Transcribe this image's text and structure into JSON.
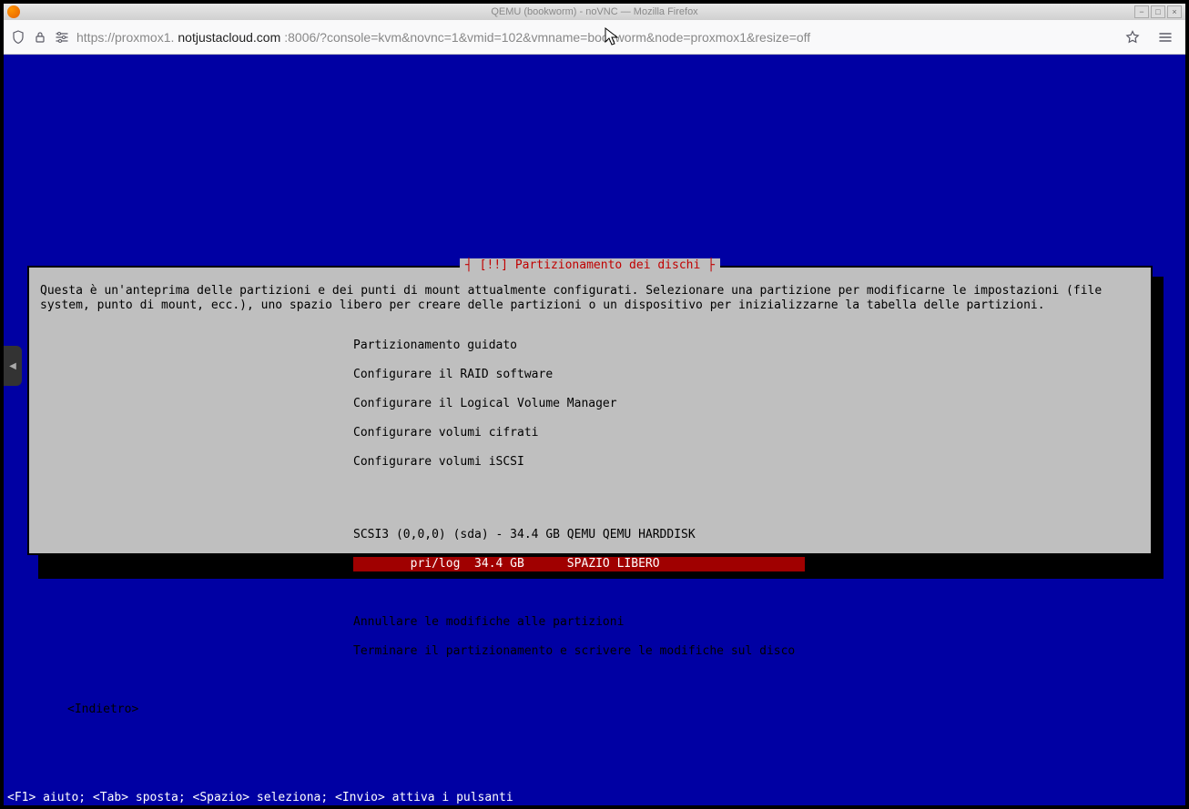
{
  "window": {
    "title": "QEMU (bookworm) - noVNC — Mozilla Firefox"
  },
  "browser": {
    "url_prefix": "https://proxmox1.",
    "url_domain": "notjustacloud.com",
    "url_suffix": ":8006/?console=kvm&novnc=1&vmid=102&vmname=bookworm&node=proxmox1&resize=off"
  },
  "novnc": {
    "tab_glyph": "◀"
  },
  "installer": {
    "title": "┤ [!!] Partizionamento dei dischi ├",
    "description": "Questa è un'anteprima delle partizioni e dei punti di mount attualmente configurati. Selezionare una partizione per modificarne le impostazioni (file system, punto di mount, ecc.), uno spazio libero per creare delle partizioni o un dispositivo per inizializzarne la tabella delle partizioni.",
    "menu": [
      "Partizionamento guidato",
      "Configurare il RAID software",
      "Configurare il Logical Volume Manager",
      "Configurare volumi cifrati",
      "Configurare volumi iSCSI"
    ],
    "disk_header": "SCSI3 (0,0,0) (sda) - 34.4 GB QEMU QEMU HARDDISK",
    "disk_free": "        pri/log  34.4 GB      SPAZIO LIBERO                 ",
    "actions": [
      "Annullare le modifiche alle partizioni",
      "Terminare il partizionamento e scrivere le modifiche sul disco"
    ],
    "back": "<Indietro>"
  },
  "statusbar": {
    "text": "<F1> aiuto; <Tab> sposta; <Spazio> seleziona; <Invio> attiva i pulsanti"
  }
}
